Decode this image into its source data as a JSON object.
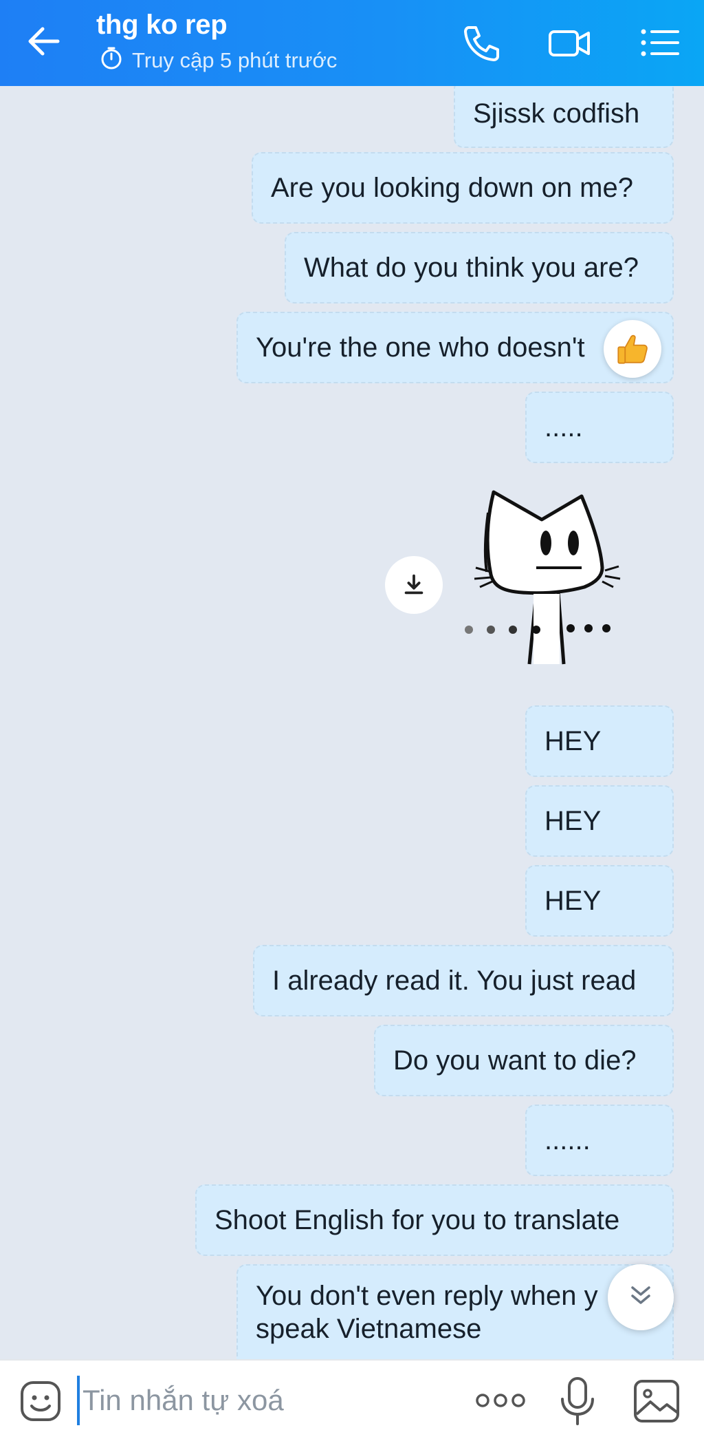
{
  "header": {
    "title": "thg ko rep",
    "status": "Truy cập 5 phút trước",
    "icons": [
      "back-arrow-icon",
      "clock-icon",
      "phone-icon",
      "video-call-icon",
      "menu-list-icon"
    ]
  },
  "messages": [
    {
      "text": "Sjissk codfish"
    },
    {
      "text": "Are you looking down on me?"
    },
    {
      "text": "What do you think you are?"
    },
    {
      "text": "You're the one who doesn't",
      "reaction": "thumbs-up-icon"
    },
    {
      "text": "....."
    },
    {
      "sticker": "cat-sticker",
      "action": "download-icon"
    },
    {
      "text": "HEY"
    },
    {
      "text": "HEY"
    },
    {
      "text": "HEY"
    },
    {
      "text": "I already read it. You just read"
    },
    {
      "text": "Do you want to die?"
    },
    {
      "text": "......"
    },
    {
      "text": "Shoot English for you to translate"
    },
    {
      "text": "You don't even reply when y speak Vietnamese"
    }
  ],
  "input": {
    "placeholder": "Tin nhắn tự xoá",
    "value": ""
  },
  "colors": {
    "header_start": "#1e7ff5",
    "header_end": "#0aa6f5",
    "bubble_bg": "#d5ecfd",
    "chat_bg": "#e2e8f1"
  }
}
